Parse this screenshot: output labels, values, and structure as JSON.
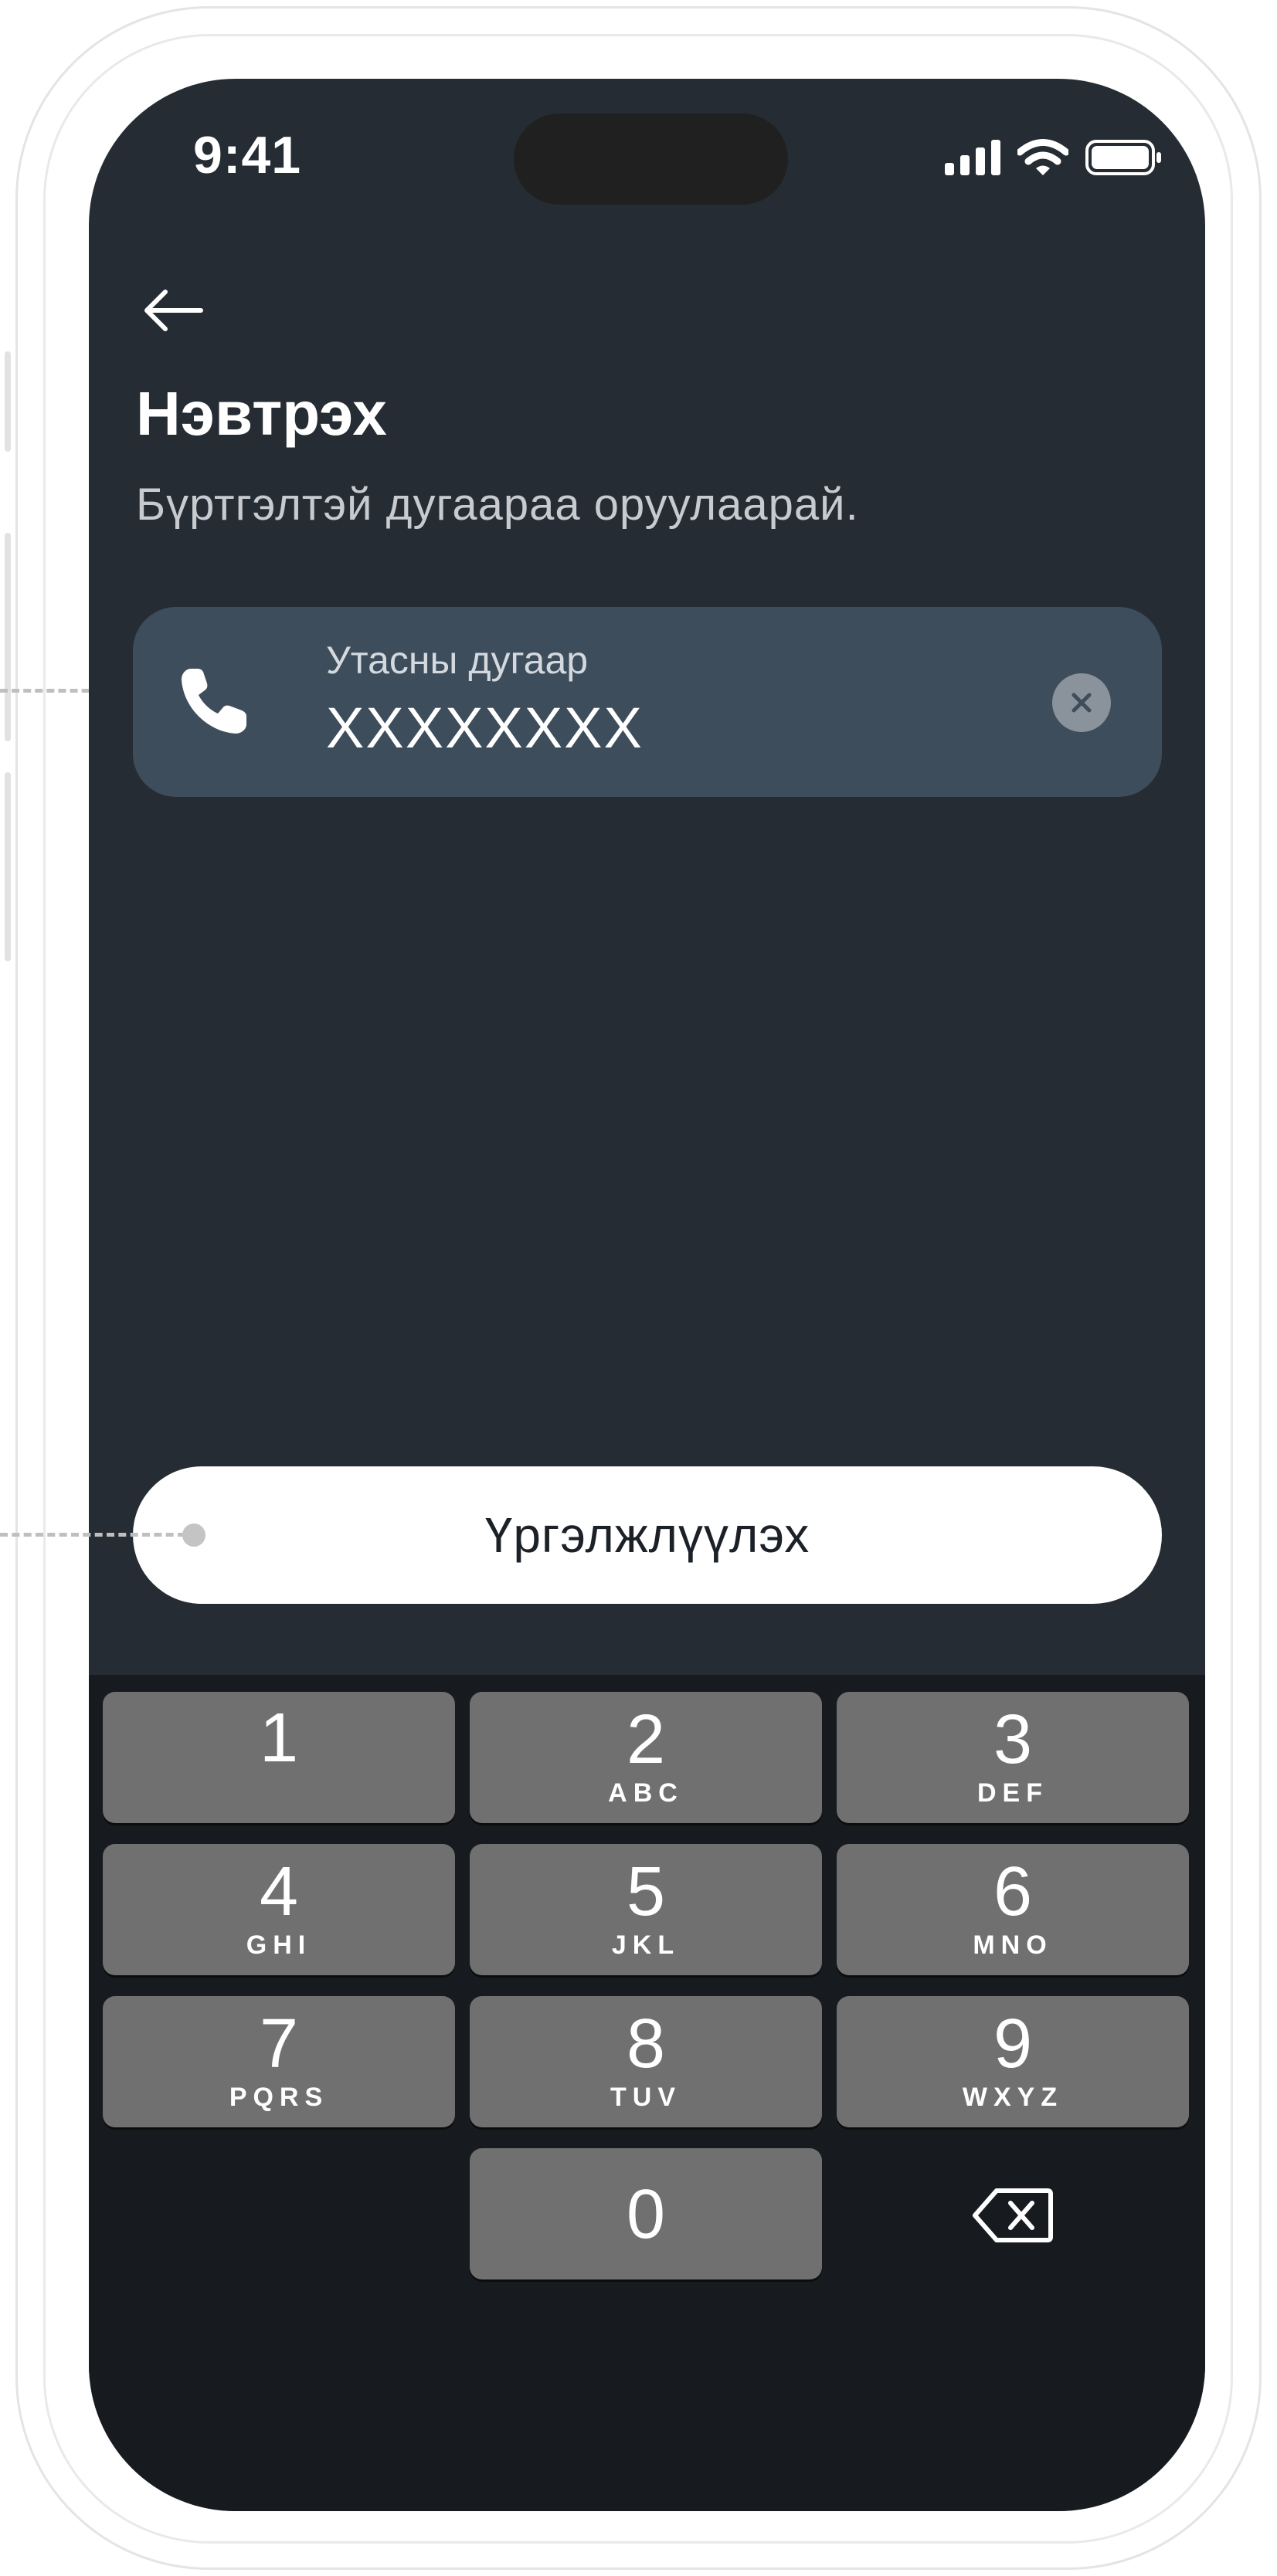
{
  "status_bar": {
    "time": "9:41",
    "icons": [
      "signal-icon",
      "wifi-icon",
      "battery-icon"
    ]
  },
  "header": {
    "back_icon": "arrow-left-icon",
    "title": "Нэвтрэх",
    "subtitle": "Бүртгэлтэй дугаараа оруулаарай."
  },
  "phone_field": {
    "icon": "phone-icon",
    "label": "Утасны дугаар",
    "value": "XXXXXXXX",
    "clear_icon": "clear-icon"
  },
  "continue_button": {
    "label": "Үргэлжлүүлэх"
  },
  "keypad": {
    "keys": [
      {
        "digit": "1",
        "letters": ""
      },
      {
        "digit": "2",
        "letters": "ABC"
      },
      {
        "digit": "3",
        "letters": "DEF"
      },
      {
        "digit": "4",
        "letters": "GHI"
      },
      {
        "digit": "5",
        "letters": "JKL"
      },
      {
        "digit": "6",
        "letters": "MNO"
      },
      {
        "digit": "7",
        "letters": "PQRS"
      },
      {
        "digit": "8",
        "letters": "TUV"
      },
      {
        "digit": "9",
        "letters": "WXYZ"
      },
      {
        "digit": "0",
        "letters": ""
      }
    ],
    "delete_icon": "backspace-icon"
  },
  "colors": {
    "screen_bg": "#262c33",
    "field_bg": "#3e4d5b",
    "keyboard_bg": "#171a1f",
    "key_bg": "#707070",
    "button_bg": "#ffffff"
  }
}
